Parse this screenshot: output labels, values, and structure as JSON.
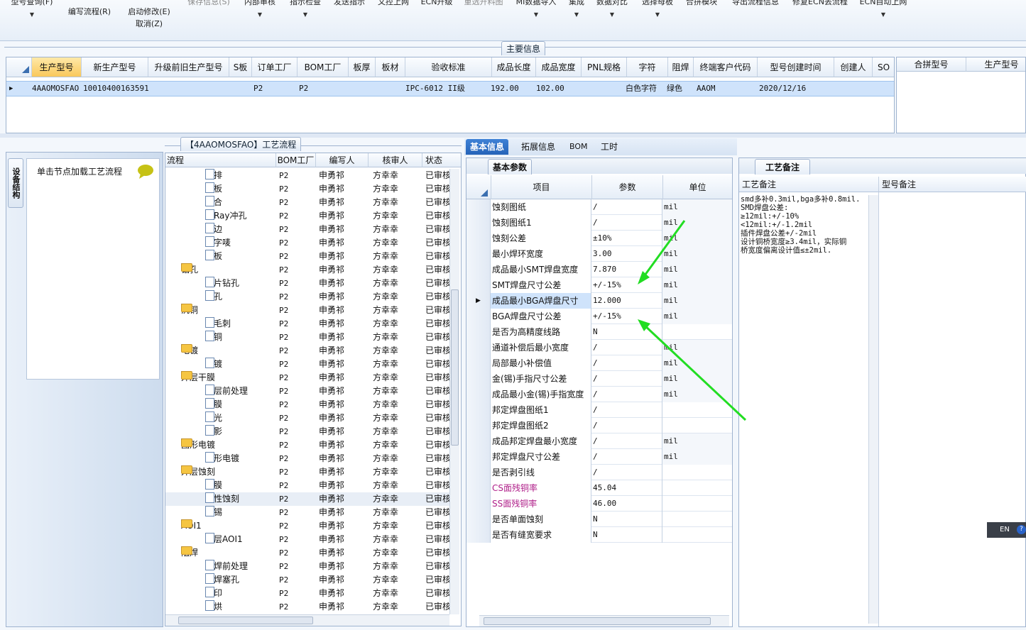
{
  "toolbar": {
    "items": [
      {
        "label": "型号查询(F)",
        "enabled": true
      },
      {
        "label": "编写流程(R)",
        "enabled": true
      },
      {
        "label": "启动修改(E)",
        "enabled": true
      },
      {
        "label": "取消(Z)",
        "enabled": true
      },
      {
        "label": "保存信息(S)",
        "enabled": false
      },
      {
        "label": "内部审核",
        "enabled": true
      },
      {
        "label": "指示检查",
        "enabled": true
      },
      {
        "label": "发送指示",
        "enabled": true
      },
      {
        "label": "文控上网",
        "enabled": true
      },
      {
        "label": "ECN升级",
        "enabled": true
      },
      {
        "label": "重选开料图",
        "enabled": false
      },
      {
        "label": "MI数据导入",
        "enabled": true
      },
      {
        "label": "集成",
        "enabled": true
      },
      {
        "label": "数据对比",
        "enabled": true
      },
      {
        "label": "选择母板",
        "enabled": true
      },
      {
        "label": "合拼模块",
        "enabled": true
      },
      {
        "label": "导出流程信息",
        "enabled": true
      },
      {
        "label": "修复ECN丢流程",
        "enabled": true
      },
      {
        "label": "ECN自动上网",
        "enabled": true
      }
    ]
  },
  "main_info": {
    "title": "主要信息",
    "columns": [
      "生产型号",
      "新生产型号",
      "升级前旧生产型号",
      "S板",
      "订单工厂",
      "BOM工厂",
      "板厚",
      "板材",
      "验收标准",
      "成品长度",
      "成品宽度",
      "PNL规格",
      "字符",
      "阻焊",
      "终端客户代码",
      "型号创建时间",
      "创建人",
      "SO"
    ],
    "row": {
      "生产型号": "4AAOMOSFAO",
      "新生产型号": "10010400163591",
      "订单工厂": "P2",
      "BOM工厂": "P2",
      "验收标准": "IPC-6012 II级",
      "成品长度": "192.00",
      "成品宽度": "102.00",
      "字符": "白色字符",
      "阻焊": "绿色",
      "终端客户代码": "AAOM",
      "型号创建时间": "2020/12/16"
    },
    "merge_columns": [
      "合拼型号",
      "生产型号"
    ]
  },
  "left_panel": {
    "vertical_tab": "设备结构",
    "hint": "单击节点加载工艺流程"
  },
  "process_flow": {
    "title": "【4AAOMOSFAO】工艺流程",
    "columns": [
      "流程",
      "BOM工厂",
      "编写人",
      "核审人",
      "状态"
    ],
    "rows": [
      {
        "name": "预排",
        "level": 2,
        "factory": "P2",
        "writer": "申勇祁",
        "reviewer": "方幸幸",
        "status": "已审核"
      },
      {
        "name": "排板",
        "level": 2,
        "factory": "P2",
        "writer": "申勇祁",
        "reviewer": "方幸幸",
        "status": "已审核"
      },
      {
        "name": "压合",
        "level": 2,
        "factory": "P2",
        "writer": "申勇祁",
        "reviewer": "方幸幸",
        "status": "已审核"
      },
      {
        "name": "X-Ray冲孔",
        "level": 2,
        "factory": "P2",
        "writer": "申勇祁",
        "reviewer": "方幸幸",
        "status": "已审核"
      },
      {
        "name": "铣边",
        "level": 2,
        "factory": "P2",
        "writer": "申勇祁",
        "reviewer": "方幸幸",
        "status": "已审核"
      },
      {
        "name": "打字唛",
        "level": 2,
        "factory": "P2",
        "writer": "申勇祁",
        "reviewer": "方幸幸",
        "status": "已审核"
      },
      {
        "name": "烘板",
        "level": 2,
        "factory": "P2",
        "writer": "申勇祁",
        "reviewer": "方幸幸",
        "status": "已审核"
      },
      {
        "name": "钻孔",
        "level": 1,
        "factory": "P2",
        "writer": "申勇祁",
        "reviewer": "方幸幸",
        "status": "已审核"
      },
      {
        "name": "铝片钻孔",
        "level": 2,
        "factory": "P2",
        "writer": "申勇祁",
        "reviewer": "方幸幸",
        "status": "已审核"
      },
      {
        "name": "钻孔",
        "level": 2,
        "factory": "P2",
        "writer": "申勇祁",
        "reviewer": "方幸幸",
        "status": "已审核"
      },
      {
        "name": "沉铜",
        "level": 1,
        "factory": "P2",
        "writer": "申勇祁",
        "reviewer": "方幸幸",
        "status": "已审核"
      },
      {
        "name": "去毛刺",
        "level": 2,
        "factory": "P2",
        "writer": "申勇祁",
        "reviewer": "方幸幸",
        "status": "已审核"
      },
      {
        "name": "沉铜",
        "level": 2,
        "factory": "P2",
        "writer": "申勇祁",
        "reviewer": "方幸幸",
        "status": "已审核"
      },
      {
        "name": "电镀",
        "level": 1,
        "factory": "P2",
        "writer": "申勇祁",
        "reviewer": "方幸幸",
        "status": "已审核"
      },
      {
        "name": "板镀",
        "level": 2,
        "factory": "P2",
        "writer": "申勇祁",
        "reviewer": "方幸幸",
        "status": "已审核"
      },
      {
        "name": "外层干膜",
        "level": 1,
        "factory": "P2",
        "writer": "申勇祁",
        "reviewer": "方幸幸",
        "status": "已审核"
      },
      {
        "name": "外层前处理",
        "level": 2,
        "factory": "P2",
        "writer": "申勇祁",
        "reviewer": "方幸幸",
        "status": "已审核"
      },
      {
        "name": "贴膜",
        "level": 2,
        "factory": "P2",
        "writer": "申勇祁",
        "reviewer": "方幸幸",
        "status": "已审核"
      },
      {
        "name": "曝光",
        "level": 2,
        "factory": "P2",
        "writer": "申勇祁",
        "reviewer": "方幸幸",
        "status": "已审核"
      },
      {
        "name": "显影",
        "level": 2,
        "factory": "P2",
        "writer": "申勇祁",
        "reviewer": "方幸幸",
        "status": "已审核"
      },
      {
        "name": "图形电镀",
        "level": 1,
        "factory": "P2",
        "writer": "申勇祁",
        "reviewer": "方幸幸",
        "status": "已审核"
      },
      {
        "name": "图形电镀",
        "level": 2,
        "factory": "P2",
        "writer": "申勇祁",
        "reviewer": "方幸幸",
        "status": "已审核"
      },
      {
        "name": "外层蚀刻",
        "level": 1,
        "factory": "P2",
        "writer": "申勇祁",
        "reviewer": "方幸幸",
        "status": "已审核"
      },
      {
        "name": "退膜",
        "level": 2,
        "factory": "P2",
        "writer": "申勇祁",
        "reviewer": "方幸幸",
        "status": "已审核"
      },
      {
        "name": "碱性蚀刻",
        "level": 2,
        "factory": "P2",
        "writer": "申勇祁",
        "reviewer": "方幸幸",
        "status": "已审核",
        "selected": true
      },
      {
        "name": "退锡",
        "level": 2,
        "factory": "P2",
        "writer": "申勇祁",
        "reviewer": "方幸幸",
        "status": "已审核"
      },
      {
        "name": "AOI1",
        "level": 1,
        "factory": "P2",
        "writer": "申勇祁",
        "reviewer": "方幸幸",
        "status": "已审核"
      },
      {
        "name": "外层AOI1",
        "level": 2,
        "factory": "P2",
        "writer": "申勇祁",
        "reviewer": "方幸幸",
        "status": "已审核"
      },
      {
        "name": "阻焊",
        "level": 1,
        "factory": "P2",
        "writer": "申勇祁",
        "reviewer": "方幸幸",
        "status": "已审核"
      },
      {
        "name": "阻焊前处理",
        "level": 2,
        "factory": "P2",
        "writer": "申勇祁",
        "reviewer": "方幸幸",
        "status": "已审核"
      },
      {
        "name": "阻焊塞孔",
        "level": 2,
        "factory": "P2",
        "writer": "申勇祁",
        "reviewer": "方幸幸",
        "status": "已审核"
      },
      {
        "name": "丝印",
        "level": 2,
        "factory": "P2",
        "writer": "申勇祁",
        "reviewer": "方幸幸",
        "status": "已审核"
      },
      {
        "name": "预烘",
        "level": 2,
        "factory": "P2",
        "writer": "申勇祁",
        "reviewer": "方幸幸",
        "status": "已审核"
      }
    ]
  },
  "detail_tabs": [
    "基本信息",
    "拓展信息",
    "BOM",
    "工时"
  ],
  "basic_params": {
    "tab": "基本参数",
    "columns": [
      "项目",
      "参数",
      "单位"
    ],
    "rows": [
      {
        "item": "蚀刻图纸",
        "value": "/",
        "unit": "mil"
      },
      {
        "item": "蚀刻图纸1",
        "value": "/",
        "unit": "mil"
      },
      {
        "item": "蚀刻公差",
        "value": "±10%",
        "unit": "mil"
      },
      {
        "item": "最小焊环宽度",
        "value": "3.00",
        "unit": "mil"
      },
      {
        "item": "成品最小SMT焊盘宽度",
        "value": "7.870",
        "unit": "mil"
      },
      {
        "item": "SMT焊盘尺寸公差",
        "value": "+/-15%",
        "unit": "mil"
      },
      {
        "item": "成品最小BGA焊盘尺寸",
        "value": "12.000",
        "unit": "mil",
        "selected": true
      },
      {
        "item": "BGA焊盘尺寸公差",
        "value": "+/-15%",
        "unit": "mil"
      },
      {
        "item": "是否为高精度线路",
        "value": "N",
        "unit": ""
      },
      {
        "item": "通道补偿后最小宽度",
        "value": "/",
        "unit": "mil"
      },
      {
        "item": "局部最小补偿值",
        "value": "/",
        "unit": "mil"
      },
      {
        "item": "金(锡)手指尺寸公差",
        "value": "/",
        "unit": "mil"
      },
      {
        "item": "成品最小金(锡)手指宽度",
        "value": "/",
        "unit": "mil"
      },
      {
        "item": "邦定焊盘图纸1",
        "value": "/",
        "unit": ""
      },
      {
        "item": "邦定焊盘图纸2",
        "value": "/",
        "unit": ""
      },
      {
        "item": "成品邦定焊盘最小宽度",
        "value": "/",
        "unit": "mil"
      },
      {
        "item": "邦定焊盘尺寸公差",
        "value": "/",
        "unit": "mil"
      },
      {
        "item": "是否剥引线",
        "value": "/",
        "unit": ""
      },
      {
        "item": "CS面残铜率",
        "value": "45.04",
        "unit": "",
        "highlight": true
      },
      {
        "item": "SS面残铜率",
        "value": "46.00",
        "unit": "",
        "highlight": true
      },
      {
        "item": "是否单面蚀刻",
        "value": "N",
        "unit": ""
      },
      {
        "item": "是否有缝宽要求",
        "value": "N",
        "unit": ""
      }
    ]
  },
  "process_notes": {
    "tab": "工艺备注",
    "columns": [
      "工艺备注",
      "型号备注"
    ],
    "note_lines": [
      "smd多补0.3mil,bga多补0.8mil.",
      "SMD焊盘公差:",
      "≥12mil:+/-10%",
      "<12mil:+/-1.2mil",
      "插件焊盘公差+/-2mil",
      "设计铜桥宽度≥3.4mil，实际铜",
      "桥宽度偏离设计值≤±2mil."
    ]
  },
  "ime": {
    "label": "EN"
  },
  "colors": {
    "accent": "#2563b8",
    "selected_row": "#cfe3fb",
    "header_selected": "#f9c85b",
    "highlight_text": "#b0208a",
    "arrow": "#22dd22"
  }
}
